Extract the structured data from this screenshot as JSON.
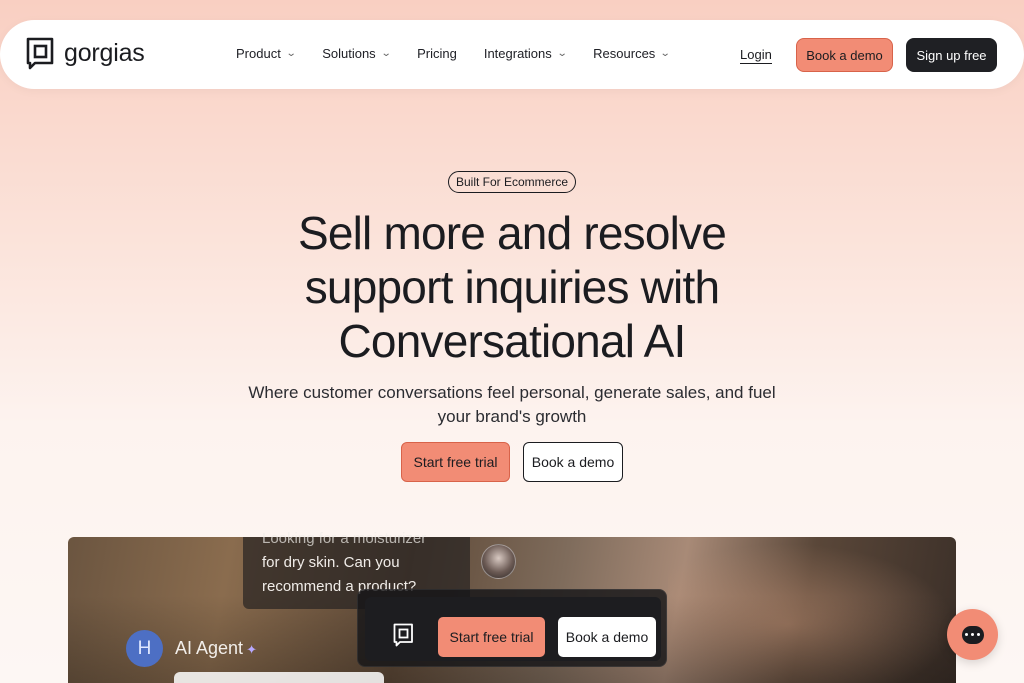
{
  "brand": {
    "name": "gorgias"
  },
  "nav": {
    "items": [
      {
        "label": "Product",
        "has_dropdown": true
      },
      {
        "label": "Solutions",
        "has_dropdown": true
      },
      {
        "label": "Pricing",
        "has_dropdown": false
      },
      {
        "label": "Integrations",
        "has_dropdown": true
      },
      {
        "label": "Resources",
        "has_dropdown": true
      }
    ],
    "login": "Login",
    "book_demo": "Book a demo",
    "sign_up": "Sign up free"
  },
  "hero": {
    "badge": "Built For Ecommerce",
    "headline_lines": [
      "Sell more and resolve",
      "support inquiries with",
      "Conversational AI"
    ],
    "subhead": "Where customer conversations feel personal, generate sales, and fuel your brand's growth",
    "cta_primary": "Start free trial",
    "cta_secondary": "Book a demo"
  },
  "media": {
    "chat_lines": [
      "Looking for a moisturizer",
      "for dry skin. Can you",
      "recommend a product?"
    ],
    "agent_initial": "H",
    "agent_label": "AI Agent"
  },
  "sticky_cta": {
    "primary": "Start free trial",
    "secondary": "Book a demo"
  },
  "colors": {
    "accent": "#f28c75",
    "dark": "#1f2024",
    "agent_avatar": "#4d6fc4"
  },
  "icons": {
    "brand": "gorgias-logo-icon",
    "dropdown": "chevron-down-icon",
    "sparkle": "sparkle-icon",
    "chat": "chat-bubble-icon"
  }
}
